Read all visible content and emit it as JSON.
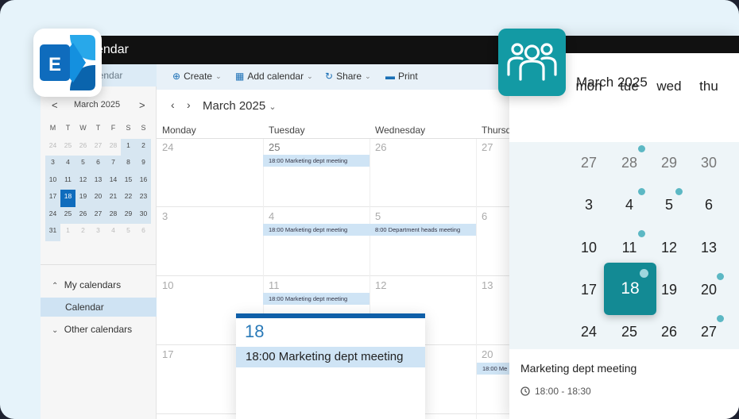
{
  "outlook": {
    "title": "endar",
    "left_header": "lendar",
    "mini_month": {
      "prev": "<",
      "next": ">",
      "title": "March 2025",
      "weekdays": [
        "M",
        "T",
        "W",
        "T",
        "F",
        "S",
        "S"
      ]
    },
    "my_calendars": "My calendars",
    "calendar_item": "Calendar",
    "other_calendars": "Other calendars",
    "toolbar": {
      "create": "Create",
      "add_calendar": "Add calendar",
      "share": "Share",
      "print": "Print"
    },
    "month_title": "March 2025",
    "day_headers": [
      "Monday",
      "Tuesday",
      "Wednesday",
      "Thursd"
    ],
    "events": {
      "e1": "18:00 Marketing dept meeting",
      "e2": "18:00 Marketing dept meeting",
      "e3": "8:00 Department heads meeting",
      "e4": "18:00 Marketing dept meeting",
      "e5": "18:00 Me"
    },
    "cells": {
      "c24": "24",
      "c25": "25",
      "c26": "26",
      "c27": "27",
      "c3": "3",
      "c4": "4",
      "c5": "5",
      "c6": "6",
      "c10": "10",
      "c11": "11",
      "c12": "12",
      "c13": "13",
      "c17": "17",
      "c20": "20"
    },
    "day_card": {
      "day": "18",
      "event": "18:00 Marketing dept meeting"
    }
  },
  "mobile": {
    "title": "March 2025",
    "weekdays": [
      "mon",
      "tue",
      "wed",
      "thu"
    ],
    "selected_day": "18",
    "event_title": "Marketing dept meeting",
    "event_time": "18:00 - 18:30"
  },
  "colors": {
    "accent_outlook": "#0f6cbd",
    "accent_teams": "#139aa4",
    "event_bg": "#cfe4f5"
  }
}
